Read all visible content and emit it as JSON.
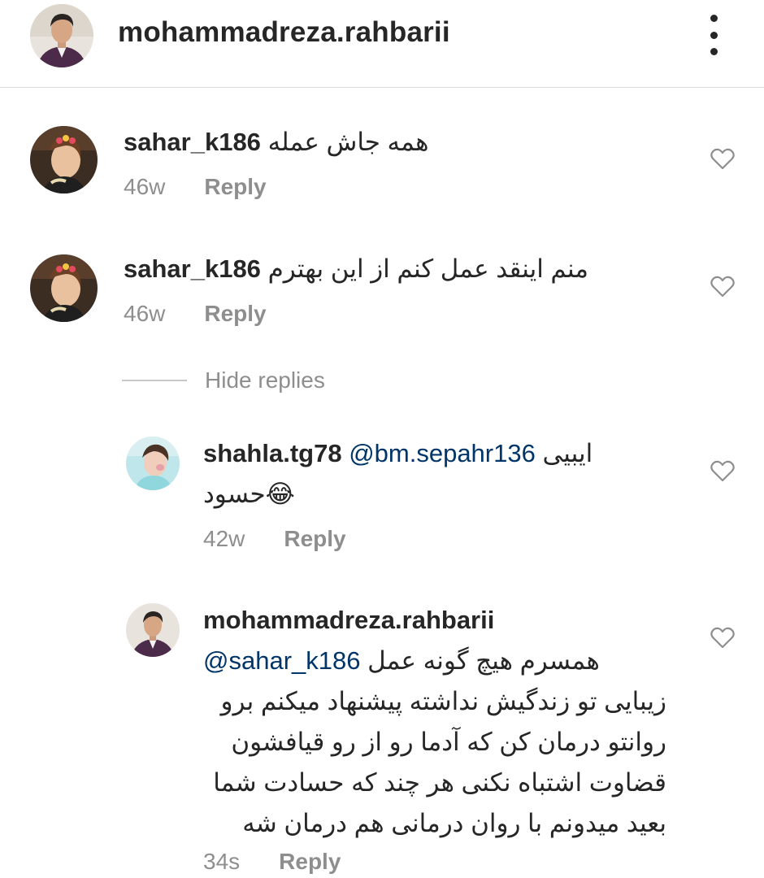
{
  "header": {
    "username": "mohammadreza.rahbarii",
    "more_icon": "more-vertical-icon"
  },
  "comments": [
    {
      "username": "sahar_k186",
      "text": "همه جاش عمله",
      "time": "46w",
      "reply_label": "Reply"
    },
    {
      "username": "sahar_k186",
      "text": "منم اینقد عمل کنم از این بهترم",
      "time": "46w",
      "reply_label": "Reply"
    }
  ],
  "hide_replies_label": "Hide replies",
  "replies": [
    {
      "username": "shahla.tg78",
      "mention": "@bm.sepahr136",
      "text_inline": "ایبیی",
      "text_line2": "حسود",
      "emoji": "😂",
      "time": "42w",
      "reply_label": "Reply"
    },
    {
      "username": "mohammadreza.rahbarii",
      "mention": "@sahar_k186",
      "lines": [
        "همسرم هیچ گونه عمل",
        "زیبایی تو زندگیش نداشته پیشنهاد میکنم برو",
        "روانتو درمان کن که آدما رو از رو قیافشون",
        "قضاوت اشتباه نکنی هر چند که حسادت شما",
        "بعید میدونم با روان درمانی هم درمان شه"
      ],
      "time": "34s",
      "reply_label": "Reply"
    }
  ],
  "colors": {
    "text": "#262626",
    "secondary": "#8e8e8e",
    "mention": "#003569",
    "divider": "#dbdbdb"
  }
}
